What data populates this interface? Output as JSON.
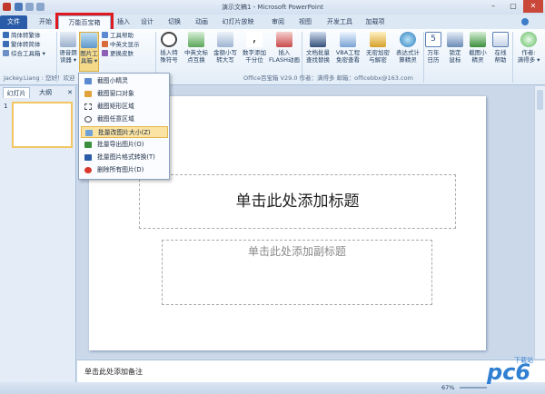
{
  "window": {
    "title": "演示文稿1 - Microsoft PowerPoint",
    "min": "–",
    "max": "▢",
    "close": "✕"
  },
  "tabs": [
    "文件",
    "开始",
    "万能百宝箱",
    "插入",
    "设计",
    "切换",
    "动画",
    "幻灯片放映",
    "审阅",
    "视图",
    "开发工具",
    "加载项"
  ],
  "ribbon": {
    "small_left": [
      "简体转繁体",
      "繁体转简体",
      "综合工具箱 ▾"
    ],
    "buttons": [
      {
        "label1": "语音朗",
        "label2": "读器 ▾"
      },
      {
        "label1": "图片工",
        "label2": "具箱 ▾"
      },
      {
        "label1": "插入特",
        "label2": "殊符号"
      },
      {
        "label1": "中英文标",
        "label2": "点互换"
      },
      {
        "label1": "金额小写",
        "label2": "转大写"
      },
      {
        "label1": "数字添加",
        "label2": "千分位"
      },
      {
        "label1": "插入",
        "label2": "FLASH动画"
      },
      {
        "label1": "文档批量",
        "label2": "查找替换"
      },
      {
        "label1": "VBA工程",
        "label2": "免密查看"
      },
      {
        "label1": "无密加密",
        "label2": "与解密"
      },
      {
        "label1": "表达式计",
        "label2": "算精灵"
      },
      {
        "label1": "万年",
        "label2": "日历"
      },
      {
        "label1": "锁定",
        "label2": "鼠标"
      },
      {
        "label1": "截图小",
        "label2": "精灵"
      },
      {
        "label1": "在线",
        "label2": "帮助"
      },
      {
        "label1": "作者:",
        "label2": "满得多 ▾"
      }
    ],
    "small_mid": [
      "工具帮助",
      "中英文显示",
      "更换皮肤"
    ],
    "group_left": "Jackey.Liang : 您好！欢迎",
    "group_info": "Office百宝箱 V29.0  作者：满得多 邮箱：officebbx@163.com"
  },
  "dropdown": {
    "items": [
      "截图小精灵",
      "截图窗口对象",
      "截图矩形区域",
      "截图任意区域",
      "批量改图片大小(Z)",
      "批量导出图片(O)",
      "批量图片格式转换(T)",
      "删除所有图片(D)"
    ],
    "highlighted_index": 4
  },
  "left_pane": {
    "tab_slides": "幻灯片",
    "tab_outline": "大纲",
    "close": "✕",
    "slide_number": "1"
  },
  "slide": {
    "title_placeholder": "单击此处添加标题",
    "subtitle_placeholder": "单击此处添加副标题"
  },
  "notes": {
    "placeholder": "单击此处添加备注"
  },
  "status": {
    "zoom": "67%",
    "watermark": "pc6",
    "watermark_sub": "下载站"
  },
  "colors": {
    "highlight_box": "#e0191f",
    "file_tab": "#2a5ba8",
    "menu_highlight": "#fbe4a3"
  }
}
